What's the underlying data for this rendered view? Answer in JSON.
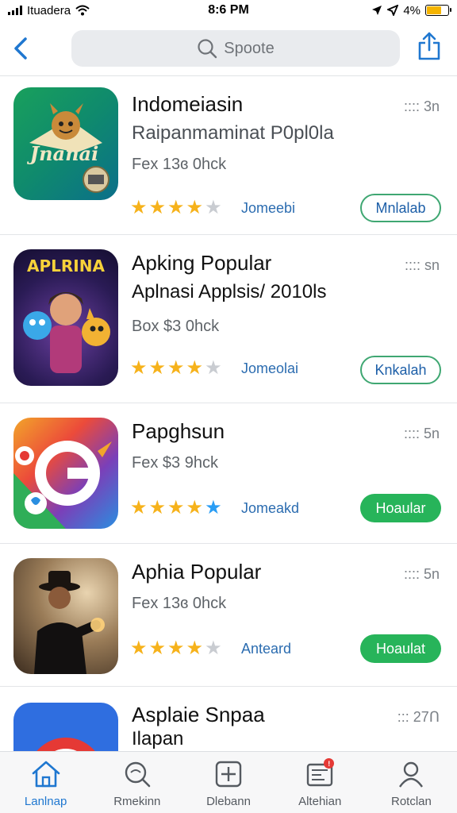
{
  "status_bar": {
    "carrier": "Ituadera",
    "time": "8:6 PM",
    "battery": "4%",
    "battery_level": 0.7
  },
  "nav": {
    "search_placeholder": "Spoote",
    "back_icon": "chevron-left-icon",
    "share_icon": "share-icon"
  },
  "apps": [
    {
      "title": "Indomeiasin",
      "subtitle": "Raipanmaminat P0pl0la",
      "meta": "Fex 13ɞ 0hck",
      "rank": "3n",
      "rating": 4,
      "category": "Jomeebi",
      "button": "Mnlalab",
      "button_style": "outline",
      "icon_text": "Jnanai"
    },
    {
      "title": "Apking Popular",
      "subtitle": "Aplnasi Applsis/ 2010ls",
      "meta": "Box $3 0hck",
      "rank": "sn",
      "rating": 4,
      "category": "Jomeolai",
      "button": "Knkalah",
      "button_style": "outline",
      "icon_text": "APLRINA"
    },
    {
      "title": "Papghsun",
      "subtitle": "",
      "meta": "Fex $3 9hck",
      "rank": "5n",
      "rating": 5,
      "category": "Jomeakd",
      "button": "Hoaular",
      "button_style": "filled",
      "icon_text": ""
    },
    {
      "title": "Aphia Popular",
      "subtitle": "",
      "meta": "Fex 13ɞ 0hck",
      "rank": "5n",
      "rating": 4,
      "category": "Anteard",
      "button": "Hoaulat",
      "button_style": "filled",
      "icon_text": ""
    },
    {
      "title": "Asplaie Snpaa",
      "subtitle": "Ilapan",
      "meta": "",
      "rank": "27Ո",
      "rating": 0,
      "category": "",
      "button": "",
      "button_style": "none",
      "icon_text": ""
    }
  ],
  "tabs": [
    {
      "label": "Lanlnap",
      "icon": "home-icon",
      "active": true
    },
    {
      "label": "Rmekinn",
      "icon": "search-icon",
      "active": false
    },
    {
      "label": "Dlebann",
      "icon": "plus-square-icon",
      "active": false
    },
    {
      "label": "Altehian",
      "icon": "news-icon",
      "active": false,
      "badge": "!"
    },
    {
      "label": "Rotclan",
      "icon": "profile-icon",
      "active": false
    }
  ],
  "colors": {
    "accent": "#1f77d0",
    "star_gold": "#f6b21b",
    "star_empty": "#c9ccd1",
    "star_blue": "#2a9df4",
    "green_button": "#27b45a"
  }
}
